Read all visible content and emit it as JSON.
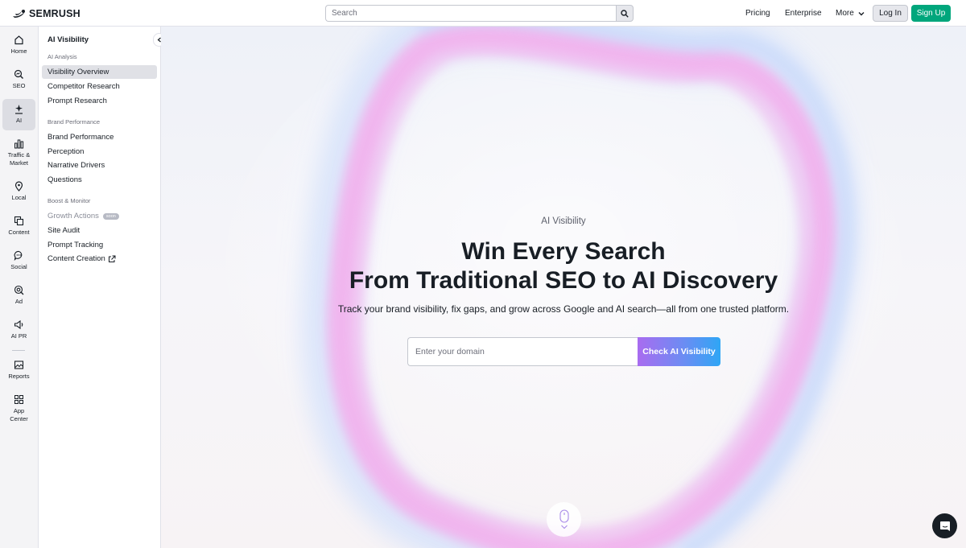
{
  "header": {
    "logo_text": "SEMRUSH",
    "search_placeholder": "Search",
    "nav": {
      "pricing": "Pricing",
      "enterprise": "Enterprise",
      "more": "More"
    },
    "login_label": "Log In",
    "signup_label": "Sign Up"
  },
  "rail": {
    "items": [
      {
        "label": "Home",
        "icon": "home-icon"
      },
      {
        "label": "SEO",
        "icon": "seo-search-icon"
      },
      {
        "label": "AI",
        "icon": "ai-sparkle-icon",
        "active": true
      },
      {
        "label": "Traffic &",
        "label2": "Market",
        "icon": "bar-chart-icon"
      },
      {
        "label": "Local",
        "icon": "location-pin-icon"
      },
      {
        "label": "Content",
        "icon": "content-copy-icon"
      },
      {
        "label": "Social",
        "icon": "chat-bubble-icon"
      },
      {
        "label": "Ad",
        "icon": "ad-target-icon"
      },
      {
        "label": "AI PR",
        "icon": "megaphone-icon"
      },
      {
        "label": "Reports",
        "icon": "image-report-icon"
      },
      {
        "label": "App",
        "label2": "Center",
        "icon": "grid-apps-icon"
      }
    ]
  },
  "sidebar": {
    "title": "AI Visibility",
    "groups": [
      {
        "label": "AI Analysis"
      },
      {
        "label": "Brand Performance"
      },
      {
        "label": "Boost & Monitor"
      }
    ],
    "items": [
      {
        "label": "Visibility Overview",
        "active": true
      },
      {
        "label": "Competitor Research"
      },
      {
        "label": "Prompt Research"
      },
      {
        "label": "Brand Performance"
      },
      {
        "label": "Perception"
      },
      {
        "label": "Narrative Drivers"
      },
      {
        "label": "Questions"
      },
      {
        "label": "Growth Actions",
        "badge": "soon",
        "disabled": true
      },
      {
        "label": "Site Audit"
      },
      {
        "label": "Prompt Tracking"
      },
      {
        "label": "Content Creation",
        "icon": "external-link-icon"
      }
    ]
  },
  "hero": {
    "eyebrow": "AI Visibility",
    "title_line1": "Win Every Search",
    "title_line2": "From Traditional SEO to AI Discovery",
    "subtitle": "Track your brand visibility, fix gaps, and grow across Google and AI search—all from one trusted platform.",
    "domain_placeholder": "Enter your domain",
    "cta_label": "Check AI Visibility"
  },
  "colors": {
    "brand_green": "#00a67c",
    "cta_gradient_start": "#a96cf0",
    "cta_gradient_end": "#2fa6f5",
    "ribbon_pink": "#f59be4",
    "text_dark": "#181e25"
  }
}
